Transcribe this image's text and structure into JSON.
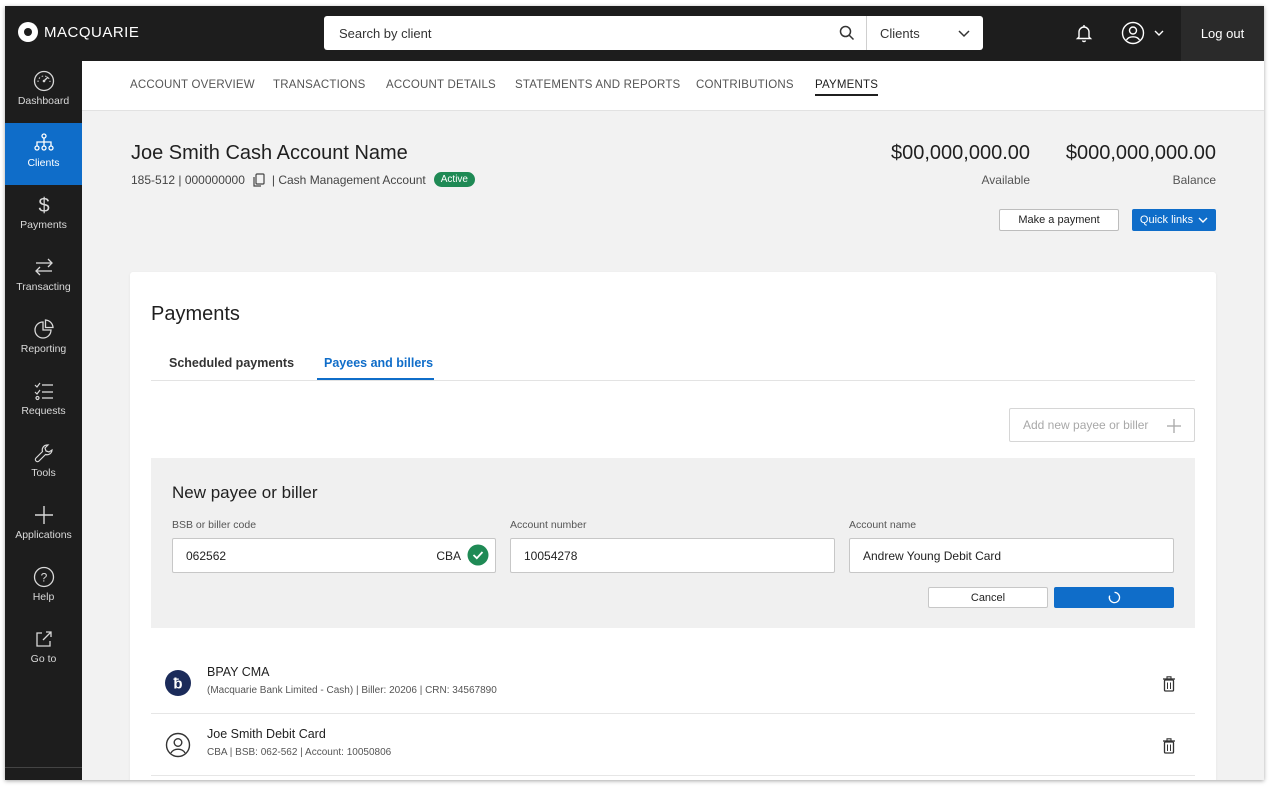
{
  "header": {
    "brand": "MACQUARIE",
    "search_placeholder": "Search by client",
    "scope_select": "Clients",
    "logout_label": "Log out"
  },
  "sidebar": {
    "items": [
      {
        "label": "Dashboard",
        "icon": "gauge-icon"
      },
      {
        "label": "Clients",
        "icon": "hierarchy-icon",
        "active": true
      },
      {
        "label": "Payments",
        "icon": "dollar-icon"
      },
      {
        "label": "Transacting",
        "icon": "transfer-arrows-icon"
      },
      {
        "label": "Reporting",
        "icon": "pie-chart-icon"
      },
      {
        "label": "Requests",
        "icon": "checklist-icon"
      },
      {
        "label": "Tools",
        "icon": "wrench-icon"
      },
      {
        "label": "Applications",
        "icon": "plus-icon"
      },
      {
        "label": "Help",
        "icon": "help-icon"
      },
      {
        "label": "Go to",
        "icon": "external-link-icon"
      }
    ]
  },
  "tabs": [
    {
      "label": "ACCOUNT OVERVIEW"
    },
    {
      "label": "TRANSACTIONS"
    },
    {
      "label": "ACCOUNT DETAILS"
    },
    {
      "label": "STATEMENTS AND REPORTS"
    },
    {
      "label": "CONTRIBUTIONS"
    },
    {
      "label": "PAYMENTS",
      "active": true
    }
  ],
  "account": {
    "name": "Joe Smith Cash Account Name",
    "number": "185-512 | 000000000",
    "type": "| Cash Management Account",
    "status": "Active",
    "available_amount": "$00,000,000.00",
    "available_label": "Available",
    "balance_amount": "$000,000,000.00",
    "balance_label": "Balance",
    "make_payment_label": "Make a payment",
    "quick_links_label": "Quick links"
  },
  "payments": {
    "title": "Payments",
    "subtabs": [
      {
        "label": "Scheduled payments"
      },
      {
        "label": "Payees and billers",
        "active": true
      }
    ],
    "add_button_label": "Add new payee or biller",
    "form": {
      "title": "New payee or biller",
      "bsb_label": "BSB or biller code",
      "bsb_value": "062562",
      "bank_code": "CBA",
      "account_number_label": "Account number",
      "account_number_value": "10054278",
      "account_name_label": "Account name",
      "account_name_value": "Andrew Young Debit Card",
      "cancel_label": "Cancel"
    },
    "payees": [
      {
        "title": "BPAY CMA",
        "subtitle": "(Macquarie Bank Limited - Cash) | Biller: 20206 | CRN: 34567890",
        "icon": "bpay-icon"
      },
      {
        "title": "Joe Smith Debit Card",
        "subtitle": "CBA | BSB: 062-562 | Account: 10050806",
        "icon": "person-icon"
      }
    ]
  },
  "colors": {
    "accent": "#0f6dc9",
    "sidebar": "#1d1d1d",
    "active_badge": "#1f8a55",
    "bpay_navy": "#1b2b5a"
  }
}
